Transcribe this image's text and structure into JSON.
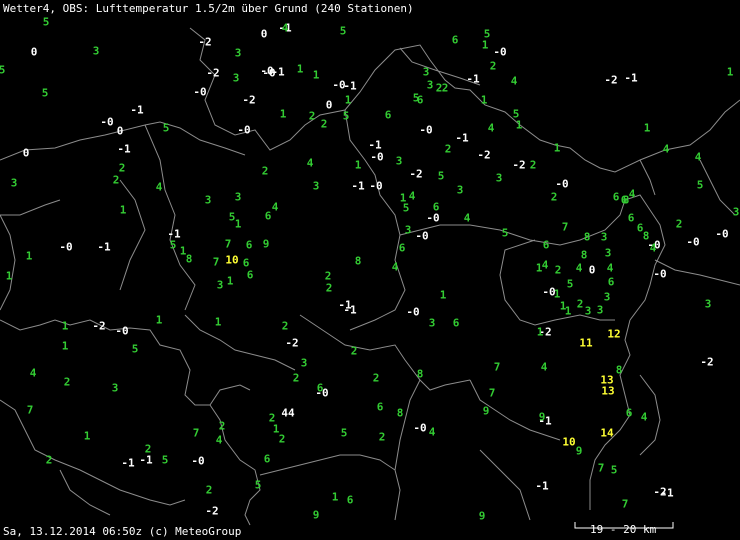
{
  "title": "Wetter4, OBS: Lufttemperatur 1.5/2m über Grund (240 Stationen)",
  "footer": "Sa, 13.12.2014 06:50z (c) MeteoGroup",
  "scale_label": "19 - 20 km",
  "colors": {
    "background": "#000000",
    "border": "#8c8c8c",
    "cold": "#ffffff",
    "mild": "#33cc33",
    "warm": "#ffff33",
    "scale": "#ffffff"
  },
  "observations": [
    {
      "v": "5"
    },
    {
      "v": "0"
    },
    {
      "v": "3"
    },
    {
      "v": "5"
    },
    {
      "v": "5"
    },
    {
      "v": "-1"
    },
    {
      "v": "-0"
    },
    {
      "v": "0"
    },
    {
      "v": "5"
    },
    {
      "v": "-1"
    },
    {
      "v": "0"
    },
    {
      "v": "2"
    },
    {
      "v": "3"
    },
    {
      "v": "2"
    },
    {
      "v": "1"
    },
    {
      "v": "4"
    },
    {
      "v": "-2"
    },
    {
      "v": "3"
    },
    {
      "v": "-2"
    },
    {
      "v": "-0"
    },
    {
      "v": "3"
    },
    {
      "v": "-2"
    },
    {
      "v": "-0"
    },
    {
      "v": "0"
    },
    {
      "v": "-1"
    },
    {
      "v": "-0"
    },
    {
      "v": "-1"
    },
    {
      "v": "-0"
    },
    {
      "v": "4"
    },
    {
      "v": "5"
    },
    {
      "v": "1"
    },
    {
      "v": "1"
    },
    {
      "v": "-0"
    },
    {
      "v": "-1"
    },
    {
      "v": "1"
    },
    {
      "v": "0"
    },
    {
      "v": "5"
    },
    {
      "v": "2"
    },
    {
      "v": "1"
    },
    {
      "v": "2"
    },
    {
      "v": "6"
    },
    {
      "v": "-1"
    },
    {
      "v": "-0"
    },
    {
      "v": "1"
    },
    {
      "v": "3"
    },
    {
      "v": "-0"
    },
    {
      "v": "2"
    },
    {
      "v": "1"
    },
    {
      "v": "3"
    },
    {
      "v": "2"
    },
    {
      "v": "3"
    },
    {
      "v": "4"
    },
    {
      "v": "6"
    },
    {
      "v": "5"
    },
    {
      "v": "4"
    },
    {
      "v": "3"
    },
    {
      "v": "-1"
    },
    {
      "v": "-0"
    },
    {
      "v": "1"
    },
    {
      "v": "7"
    },
    {
      "v": "7"
    },
    {
      "v": "6"
    },
    {
      "v": "9"
    },
    {
      "v": "10"
    },
    {
      "v": "1"
    },
    {
      "v": "3"
    },
    {
      "v": "6"
    },
    {
      "v": "6"
    },
    {
      "v": "-1"
    },
    {
      "v": "5"
    },
    {
      "v": "8"
    },
    {
      "v": "1"
    },
    {
      "v": "1"
    },
    {
      "v": "2"
    },
    {
      "v": "-2"
    },
    {
      "v": "2"
    },
    {
      "v": "2"
    },
    {
      "v": "3"
    },
    {
      "v": "8"
    },
    {
      "v": "5"
    },
    {
      "v": "4"
    },
    {
      "v": "3"
    },
    {
      "v": "6"
    },
    {
      "v": "4"
    },
    {
      "v": "-0"
    },
    {
      "v": "6"
    },
    {
      "v": "-0"
    },
    {
      "v": "4"
    },
    {
      "v": "-0"
    },
    {
      "v": "4"
    },
    {
      "v": "5"
    },
    {
      "v": "-1"
    },
    {
      "v": "-2"
    },
    {
      "v": "5"
    },
    {
      "v": "3"
    },
    {
      "v": "3"
    },
    {
      "v": "5"
    },
    {
      "v": "4"
    },
    {
      "v": "-1"
    },
    {
      "v": "-2"
    },
    {
      "v": "1"
    },
    {
      "v": "3"
    },
    {
      "v": "5"
    },
    {
      "v": "2"
    },
    {
      "v": "6"
    },
    {
      "v": "1"
    },
    {
      "v": "5"
    },
    {
      "v": "-0"
    },
    {
      "v": "3"
    },
    {
      "v": "6"
    },
    {
      "v": "1"
    },
    {
      "v": "-1"
    },
    {
      "v": "-1"
    },
    {
      "v": "2"
    },
    {
      "v": "2"
    },
    {
      "v": "8"
    },
    {
      "v": "6"
    },
    {
      "v": "2"
    },
    {
      "v": "8"
    },
    {
      "v": "2"
    },
    {
      "v": "7"
    },
    {
      "v": "6"
    },
    {
      "v": "4"
    },
    {
      "v": "8"
    },
    {
      "v": "3"
    },
    {
      "v": "6"
    },
    {
      "v": "3"
    },
    {
      "v": "4"
    },
    {
      "v": "6"
    },
    {
      "v": "3"
    },
    {
      "v": "3"
    },
    {
      "v": "0"
    },
    {
      "v": "4"
    },
    {
      "v": "8"
    },
    {
      "v": "8"
    },
    {
      "v": "6"
    },
    {
      "v": "6"
    },
    {
      "v": "6"
    },
    {
      "v": "8"
    },
    {
      "v": "-0"
    },
    {
      "v": "-0"
    },
    {
      "v": "2"
    },
    {
      "v": "1"
    },
    {
      "v": "5"
    },
    {
      "v": "2"
    },
    {
      "v": "3"
    },
    {
      "v": "-2"
    },
    {
      "v": "1"
    },
    {
      "v": "11"
    },
    {
      "v": "12"
    },
    {
      "v": "1"
    },
    {
      "v": "1"
    },
    {
      "v": "1"
    },
    {
      "v": "2"
    },
    {
      "v": "-0"
    },
    {
      "v": "4"
    },
    {
      "v": "7"
    },
    {
      "v": "13"
    },
    {
      "v": "13"
    },
    {
      "v": "8"
    },
    {
      "v": "7"
    },
    {
      "v": "9"
    },
    {
      "v": "6"
    },
    {
      "v": "4"
    },
    {
      "v": "14"
    },
    {
      "v": "10"
    },
    {
      "v": "9"
    },
    {
      "v": "9"
    },
    {
      "v": "7"
    },
    {
      "v": "5"
    },
    {
      "v": "7"
    },
    {
      "v": "9"
    },
    {
      "v": "-1"
    },
    {
      "v": "-1"
    },
    {
      "v": "4"
    },
    {
      "v": "-0"
    },
    {
      "v": "3"
    },
    {
      "v": "2"
    },
    {
      "v": "6"
    },
    {
      "v": "1"
    },
    {
      "v": "2"
    },
    {
      "v": "-2"
    },
    {
      "v": "1"
    },
    {
      "v": "2"
    },
    {
      "v": "1"
    },
    {
      "v": "4"
    },
    {
      "v": "4"
    },
    {
      "v": "5"
    },
    {
      "v": "4"
    },
    {
      "v": "2"
    },
    {
      "v": "4"
    },
    {
      "v": "-0"
    },
    {
      "v": "3"
    },
    {
      "v": "-2"
    },
    {
      "v": "-1"
    },
    {
      "v": "-0"
    },
    {
      "v": "-0"
    },
    {
      "v": "-2"
    },
    {
      "v": "-1"
    },
    {
      "v": "-2"
    },
    {
      "v": "1"
    },
    {
      "v": "3"
    },
    {
      "v": "-0"
    },
    {
      "v": "-1"
    },
    {
      "v": "1"
    },
    {
      "v": "1"
    },
    {
      "v": "1"
    },
    {
      "v": "-2"
    },
    {
      "v": "-0"
    },
    {
      "v": "5"
    },
    {
      "v": "1"
    },
    {
      "v": "1"
    },
    {
      "v": "2"
    },
    {
      "v": "3"
    },
    {
      "v": "4"
    },
    {
      "v": "7"
    },
    {
      "v": "1"
    },
    {
      "v": "2"
    },
    {
      "v": "-1"
    },
    {
      "v": "-1"
    },
    {
      "v": "2"
    },
    {
      "v": "5"
    },
    {
      "v": "7"
    },
    {
      "v": "2"
    },
    {
      "v": "-0"
    },
    {
      "v": "-2"
    },
    {
      "v": "5"
    },
    {
      "v": "6"
    },
    {
      "v": "2"
    },
    {
      "v": "1"
    },
    {
      "v": "2"
    },
    {
      "v": "4"
    },
    {
      "v": "44"
    },
    {
      "v": "5"
    },
    {
      "v": "-0"
    },
    {
      "v": "6"
    },
    {
      "v": "6"
    },
    {
      "v": "1"
    },
    {
      "v": "9"
    },
    {
      "v": "2"
    }
  ]
}
